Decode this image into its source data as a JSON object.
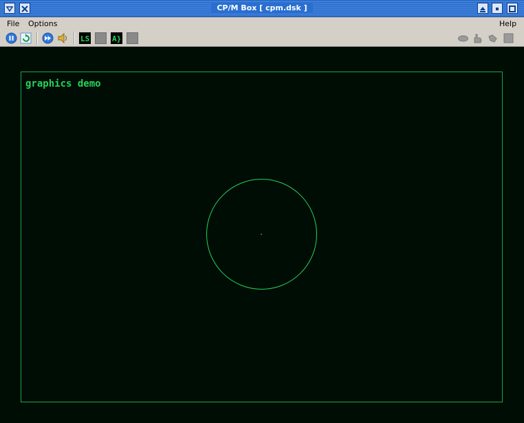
{
  "window": {
    "title": "CP/M Box   [ cpm.dsk ]"
  },
  "menu": {
    "file": "File",
    "options": "Options",
    "help": "Help"
  },
  "toolbar": {
    "ls_label": "LS",
    "a_label": "A}"
  },
  "screen": {
    "text": "graphics demo",
    "accent_color": "#26d45a",
    "background_color": "#000d05"
  }
}
